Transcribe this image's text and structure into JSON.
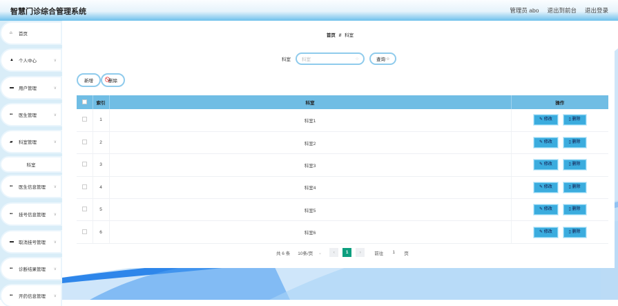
{
  "header": {
    "title": "智慧门诊综合管理系统",
    "user": "管理员 abo",
    "to_front": "退出到前台",
    "logout": "退出登录"
  },
  "sidebar": {
    "items": [
      {
        "label": "首页",
        "icon": "home-icon",
        "chev": false
      },
      {
        "label": "个人中心",
        "icon": "user-icon",
        "chev": true
      },
      {
        "label": "用户管理",
        "icon": "card-icon",
        "chev": true
      },
      {
        "label": "医生管理",
        "icon": "grid-icon",
        "chev": true
      },
      {
        "label": "科室管理",
        "icon": "briefcase-icon",
        "chev": true
      },
      {
        "label": "科室",
        "sub": true
      },
      {
        "label": "医生信息管理",
        "icon": "grid-icon",
        "chev": true
      },
      {
        "label": "挂号信息管理",
        "icon": "grid-icon",
        "chev": true
      },
      {
        "label": "取消挂号管理",
        "icon": "ticket-icon",
        "chev": true
      },
      {
        "label": "诊断结果管理",
        "icon": "grid-icon",
        "chev": true
      },
      {
        "label": "开药信息管理",
        "icon": "grid-icon",
        "chev": true
      }
    ]
  },
  "breadcrumb": {
    "home": "首页",
    "sep": "//",
    "current": "科室"
  },
  "search": {
    "label": "科室",
    "placeholder": "科室",
    "button": "查询"
  },
  "actions": {
    "add": "新增",
    "delete": "删除"
  },
  "table": {
    "headers": [
      "索引",
      "科室",
      "操作"
    ],
    "rows": [
      {
        "index": "1",
        "name": "科室1"
      },
      {
        "index": "2",
        "name": "科室2"
      },
      {
        "index": "3",
        "name": "科室3"
      },
      {
        "index": "4",
        "name": "科室4"
      },
      {
        "index": "5",
        "name": "科室5"
      },
      {
        "index": "6",
        "name": "科室6"
      }
    ],
    "edit": "修改",
    "delete": "删除"
  },
  "pagination": {
    "total": "共 6 条",
    "page_size": "10条/页",
    "current": "1",
    "goto": "前往",
    "goto_value": "1",
    "page_unit": "页"
  }
}
